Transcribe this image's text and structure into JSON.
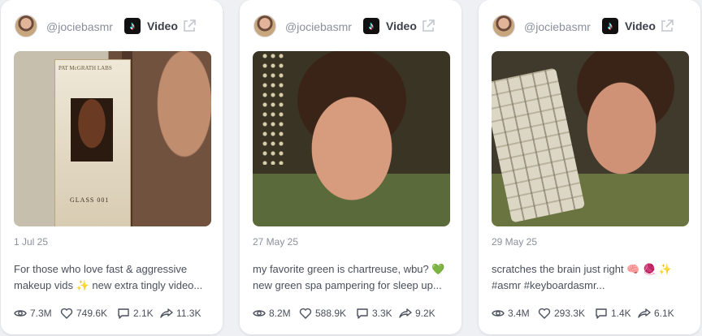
{
  "platform_label": "Video",
  "cards": [
    {
      "handle": "@jociebasmr",
      "date": "1 Jul 25",
      "caption_line1": "For those who love fast & aggressive",
      "caption_line2": "makeup vids ✨ new extra tingly video...",
      "views": "7.3M",
      "likes": "749.6K",
      "comments": "2.1K",
      "shares": "11.3K",
      "thumbnail_text_top": "PAT McGRATH LABS",
      "thumbnail_text_mid": "GLASS 001"
    },
    {
      "handle": "@jociebasmr",
      "date": "27 May 25",
      "caption_line1": "my favorite green is chartreuse, wbu? 💚",
      "caption_line2": "new green spa pampering for sleep up...",
      "views": "8.2M",
      "likes": "588.9K",
      "comments": "3.3K",
      "shares": "9.2K"
    },
    {
      "handle": "@jociebasmr",
      "date": "29 May 25",
      "caption_line1": "scratches the brain just right 🧠 🧶 ✨",
      "caption_line2": "#asmr #keyboardasmr...",
      "views": "3.4M",
      "likes": "293.3K",
      "comments": "1.4K",
      "shares": "6.1K"
    }
  ],
  "icons": {
    "platform": "tiktok-logo-icon",
    "external": "external-link-icon",
    "views": "eye-icon",
    "likes": "heart-icon",
    "comments": "comment-icon",
    "shares": "share-icon"
  }
}
